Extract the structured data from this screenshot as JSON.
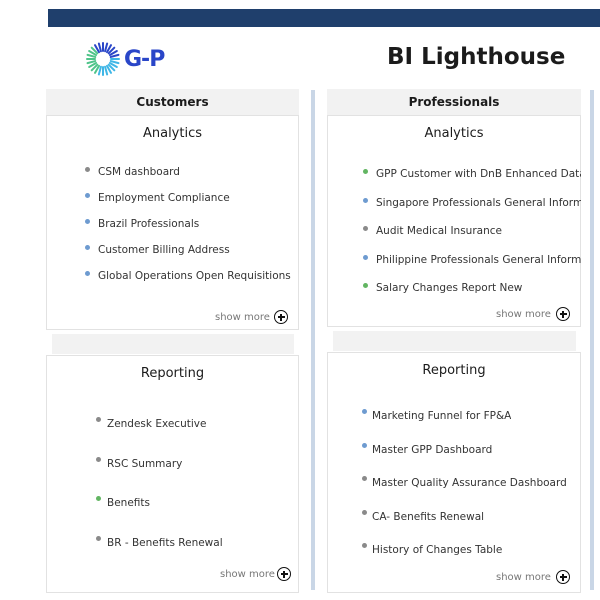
{
  "header": {
    "logo_text": "G-P",
    "title": "BI Lighthouse"
  },
  "columns": {
    "customers": {
      "header": "Customers",
      "analytics": {
        "title": "Analytics",
        "items": [
          {
            "label": "CSM dashboard",
            "dot": "gray"
          },
          {
            "label": "Employment Compliance",
            "dot": "blue"
          },
          {
            "label": "Brazil Professionals",
            "dot": "blue"
          },
          {
            "label": "Customer Billing Address",
            "dot": "blue"
          },
          {
            "label": "Global Operations Open Requisitions",
            "dot": "blue"
          }
        ],
        "show_more": "show more"
      },
      "reporting": {
        "title": "Reporting",
        "items": [
          {
            "label": "Zendesk Executive",
            "dot": "gray"
          },
          {
            "label": "RSC Summary",
            "dot": "gray"
          },
          {
            "label": "Benefits",
            "dot": "green"
          },
          {
            "label": "BR - Benefits Renewal",
            "dot": "gray"
          }
        ],
        "show_more": "show more"
      }
    },
    "professionals": {
      "header": "Professionals",
      "analytics": {
        "title": "Analytics",
        "items": [
          {
            "label": "GPP Customer with DnB Enhanced Data",
            "dot": "green"
          },
          {
            "label": "Singapore Professionals General Information",
            "dot": "blue"
          },
          {
            "label": "Audit Medical Insurance",
            "dot": "gray"
          },
          {
            "label": "Philippine Professionals General Information",
            "dot": "blue"
          },
          {
            "label": "Salary Changes Report New",
            "dot": "green"
          }
        ],
        "show_more": "show more"
      },
      "reporting": {
        "title": "Reporting",
        "items": [
          {
            "label": "Marketing Funnel for FP&A",
            "dot": "blue"
          },
          {
            "label": "Master GPP Dashboard",
            "dot": "blue"
          },
          {
            "label": "Master Quality Assurance Dashboard",
            "dot": "gray"
          },
          {
            "label": "CA- Benefits Renewal",
            "dot": "gray"
          },
          {
            "label": "History of Changes Table",
            "dot": "gray"
          }
        ],
        "show_more": "show more"
      }
    }
  },
  "colors": {
    "topbar": "#1f3f6c",
    "logo": "#2a46c8",
    "dot_gray": "#8a8a8a",
    "dot_blue": "#6e9bd0",
    "dot_green": "#62b562"
  },
  "icons": {
    "show_more": "circle-plus-icon",
    "logo": "sunburst-logo-icon"
  }
}
